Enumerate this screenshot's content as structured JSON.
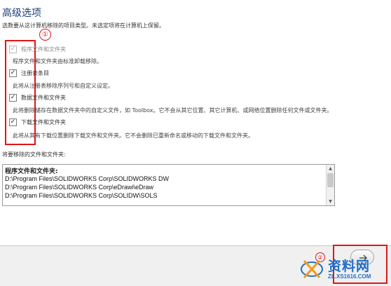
{
  "page": {
    "title": "高级选项",
    "intro": "选数要从这计算机移除的项目类型。未选定项将在计算机上保留。"
  },
  "options": [
    {
      "label": "程序文件和文件夹",
      "description": "程序文件和文件夹由标准卸载移除。",
      "checked": true,
      "disabled": true
    },
    {
      "label": "注册表条目",
      "description": "此将从注册表移除序列号和自定义设定。",
      "checked": true,
      "disabled": false
    },
    {
      "label": "数据文件和文件夹",
      "description": "此将删除储存在数据文件夹中的自定义文件，如 Toolbox。它不会从其它位置、其它计算机、或网络位置删除任何文件或文件夹。",
      "checked": true,
      "disabled": false
    },
    {
      "label": "下载文件和文件夹",
      "description": "此将从其有下载位置删除下载文件和文件夹。它不会删除已重新命名或移动的下载文件和文件夹。",
      "checked": true,
      "disabled": false
    }
  ],
  "annotations": {
    "step1": "①",
    "step2": "②",
    "color": "#e01616"
  },
  "files": {
    "label": "将要移除的文件和文件夹:",
    "header": "程序文件和文件夹:",
    "lines": [
      "D:\\Program Files\\SOLIDWORKS Corp\\SOLIDWORKS DW",
      "D:\\Program Files\\SOLIDWORKS Corp\\eDrawi\\eDraw",
      "D:\\Program Files\\SOLIDWORKS Corp\\SOLIDW\\SOLS"
    ]
  },
  "footer": {
    "next_icon": "arrow-right-icon"
  },
  "watermark": {
    "text": "资料网",
    "url": "ZL.XS1616.COM",
    "accent": "#1f6fc8"
  }
}
